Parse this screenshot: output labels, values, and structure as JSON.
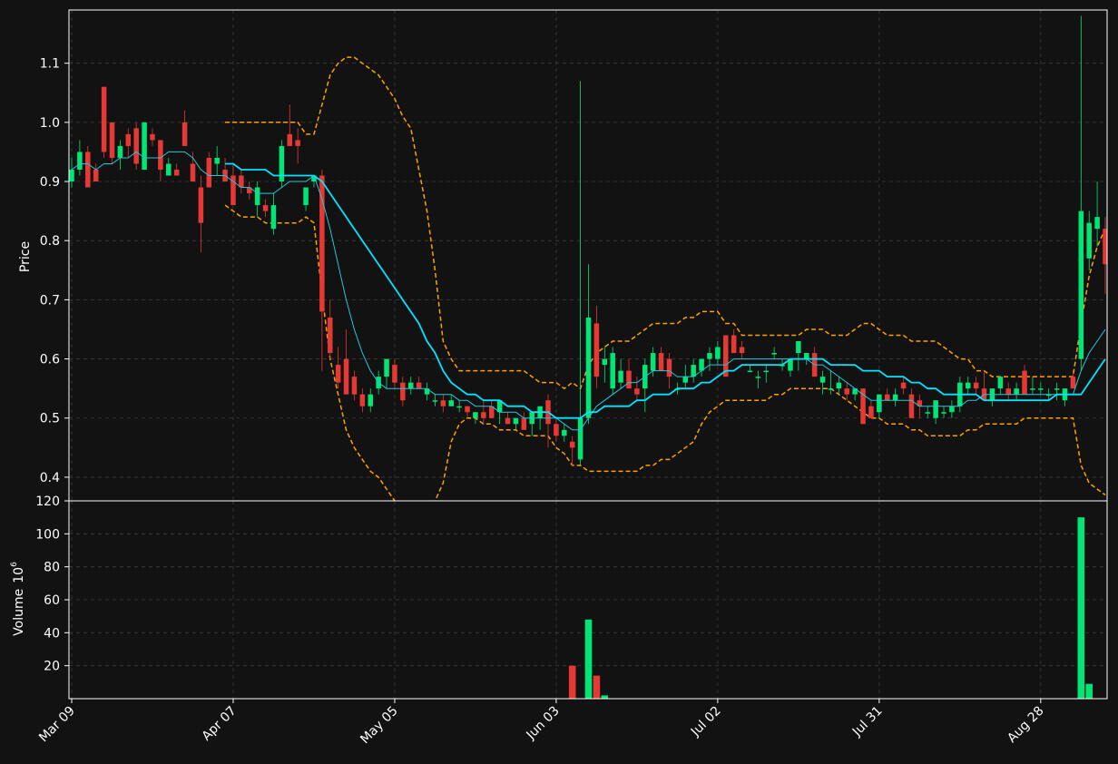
{
  "chart_data": {
    "type": "candlestick",
    "ylabel_price": "Price",
    "ylabel_volume": "Volume",
    "volume_unit": "10",
    "volume_unit_exp": "6",
    "colors": {
      "background": "#121212",
      "up": "#00e676",
      "down": "#e53935",
      "ma_fast": "#26c6da",
      "ma_slow": "#00e5ff",
      "bollinger": "#ffa000",
      "grid": "#3a3a3a",
      "axis": "#ffffff"
    },
    "grid": true,
    "x_tick_labels": [
      "Mar 09",
      "Apr 07",
      "May 05",
      "Jun 03",
      "Jul 02",
      "Jul 31",
      "Aug 28"
    ],
    "x_tick_index": [
      0,
      20,
      40,
      60,
      80,
      100,
      120
    ],
    "price_ylim": [
      0.36,
      1.19
    ],
    "price_ticks": [
      "0.4",
      "0.5",
      "0.6",
      "0.7",
      "0.8",
      "0.9",
      "1.0",
      "1.1"
    ],
    "volume_ylim": [
      0,
      120
    ],
    "volume_ticks": [
      "20",
      "40",
      "60",
      "80",
      "100",
      "120"
    ],
    "candles": [
      [
        0.9,
        0.94,
        0.89,
        0.92
      ],
      [
        0.92,
        0.97,
        0.91,
        0.95
      ],
      [
        0.95,
        0.96,
        0.89,
        0.89
      ],
      [
        0.92,
        0.93,
        0.9,
        0.9
      ],
      [
        1.06,
        1.06,
        0.94,
        0.95
      ],
      [
        1.0,
        1.0,
        0.93,
        0.94
      ],
      [
        0.94,
        0.97,
        0.92,
        0.96
      ],
      [
        0.98,
        0.99,
        0.94,
        0.96
      ],
      [
        0.99,
        1.0,
        0.92,
        0.93
      ],
      [
        0.92,
        1.0,
        0.92,
        1.0
      ],
      [
        0.98,
        0.99,
        0.96,
        0.97
      ],
      [
        0.97,
        0.97,
        0.9,
        0.92
      ],
      [
        0.91,
        0.94,
        0.91,
        0.93
      ],
      [
        0.92,
        0.93,
        0.91,
        0.91
      ],
      [
        1.0,
        1.02,
        0.96,
        0.96
      ],
      [
        0.93,
        0.95,
        0.9,
        0.9
      ],
      [
        0.89,
        0.91,
        0.78,
        0.83
      ],
      [
        0.94,
        0.95,
        0.89,
        0.89
      ],
      [
        0.93,
        0.96,
        0.91,
        0.94
      ],
      [
        0.92,
        0.94,
        0.91,
        0.9
      ],
      [
        0.91,
        0.93,
        0.86,
        0.86
      ],
      [
        0.91,
        0.92,
        0.88,
        0.89
      ],
      [
        0.89,
        0.9,
        0.87,
        0.88
      ],
      [
        0.86,
        0.9,
        0.84,
        0.89
      ],
      [
        0.86,
        0.87,
        0.84,
        0.85
      ],
      [
        0.82,
        0.88,
        0.81,
        0.86
      ],
      [
        0.9,
        0.97,
        0.89,
        0.96
      ],
      [
        0.98,
        1.03,
        0.96,
        0.96
      ],
      [
        0.97,
        0.99,
        0.93,
        0.96
      ],
      [
        0.86,
        0.88,
        0.85,
        0.89
      ],
      [
        0.9,
        0.91,
        0.89,
        0.91
      ],
      [
        0.91,
        0.92,
        0.58,
        0.68
      ],
      [
        0.67,
        0.7,
        0.6,
        0.61
      ],
      [
        0.59,
        0.62,
        0.55,
        0.56
      ],
      [
        0.6,
        0.65,
        0.55,
        0.54
      ],
      [
        0.57,
        0.58,
        0.53,
        0.54
      ],
      [
        0.54,
        0.55,
        0.51,
        0.52
      ],
      [
        0.52,
        0.55,
        0.51,
        0.54
      ],
      [
        0.55,
        0.58,
        0.54,
        0.57
      ],
      [
        0.57,
        0.6,
        0.55,
        0.6
      ],
      [
        0.59,
        0.6,
        0.55,
        0.56
      ],
      [
        0.56,
        0.57,
        0.52,
        0.53
      ],
      [
        0.55,
        0.57,
        0.54,
        0.56
      ],
      [
        0.56,
        0.57,
        0.55,
        0.55
      ],
      [
        0.54,
        0.56,
        0.53,
        0.55
      ],
      [
        0.53,
        0.54,
        0.52,
        0.53
      ],
      [
        0.53,
        0.54,
        0.51,
        0.52
      ],
      [
        0.52,
        0.54,
        0.52,
        0.53
      ],
      [
        0.52,
        0.53,
        0.51,
        0.52
      ],
      [
        0.52,
        0.52,
        0.5,
        0.51
      ],
      [
        0.5,
        0.51,
        0.49,
        0.51
      ],
      [
        0.51,
        0.53,
        0.49,
        0.5
      ],
      [
        0.52,
        0.53,
        0.5,
        0.5
      ],
      [
        0.51,
        0.53,
        0.49,
        0.53
      ],
      [
        0.5,
        0.51,
        0.49,
        0.49
      ],
      [
        0.49,
        0.5,
        0.48,
        0.5
      ],
      [
        0.5,
        0.51,
        0.48,
        0.48
      ],
      [
        0.49,
        0.51,
        0.47,
        0.51
      ],
      [
        0.5,
        0.52,
        0.48,
        0.52
      ],
      [
        0.53,
        0.54,
        0.45,
        0.49
      ],
      [
        0.49,
        0.5,
        0.46,
        0.47
      ],
      [
        0.47,
        0.49,
        0.46,
        0.48
      ],
      [
        0.46,
        0.47,
        0.42,
        0.45
      ],
      [
        0.43,
        1.07,
        0.42,
        0.5
      ],
      [
        0.5,
        0.76,
        0.49,
        0.67
      ],
      [
        0.66,
        0.69,
        0.55,
        0.57
      ],
      [
        0.59,
        0.62,
        0.56,
        0.6
      ],
      [
        0.55,
        0.62,
        0.54,
        0.61
      ],
      [
        0.56,
        0.6,
        0.55,
        0.58
      ],
      [
        0.58,
        0.6,
        0.55,
        0.55
      ],
      [
        0.55,
        0.57,
        0.53,
        0.54
      ],
      [
        0.55,
        0.6,
        0.51,
        0.59
      ],
      [
        0.58,
        0.62,
        0.57,
        0.61
      ],
      [
        0.61,
        0.62,
        0.58,
        0.58
      ],
      [
        0.6,
        0.61,
        0.55,
        0.57
      ],
      [
        0.55,
        0.56,
        0.54,
        0.55
      ],
      [
        0.56,
        0.59,
        0.55,
        0.57
      ],
      [
        0.57,
        0.6,
        0.56,
        0.59
      ],
      [
        0.58,
        0.6,
        0.57,
        0.6
      ],
      [
        0.6,
        0.62,
        0.58,
        0.61
      ],
      [
        0.6,
        0.63,
        0.59,
        0.62
      ],
      [
        0.64,
        0.64,
        0.57,
        0.57
      ],
      [
        0.64,
        0.65,
        0.61,
        0.61
      ],
      [
        0.62,
        0.63,
        0.6,
        0.61
      ],
      [
        0.58,
        0.59,
        0.58,
        0.58
      ],
      [
        0.57,
        0.58,
        0.55,
        0.57
      ],
      [
        0.58,
        0.59,
        0.56,
        0.58
      ],
      [
        0.61,
        0.62,
        0.6,
        0.61
      ],
      [
        0.59,
        0.6,
        0.58,
        0.59
      ],
      [
        0.58,
        0.6,
        0.57,
        0.6
      ],
      [
        0.61,
        0.63,
        0.58,
        0.63
      ],
      [
        0.6,
        0.61,
        0.59,
        0.61
      ],
      [
        0.61,
        0.62,
        0.57,
        0.57
      ],
      [
        0.56,
        0.58,
        0.54,
        0.57
      ],
      [
        0.55,
        0.58,
        0.54,
        0.55
      ],
      [
        0.55,
        0.57,
        0.54,
        0.56
      ],
      [
        0.55,
        0.56,
        0.53,
        0.54
      ],
      [
        0.54,
        0.55,
        0.53,
        0.55
      ],
      [
        0.55,
        0.55,
        0.49,
        0.49
      ],
      [
        0.52,
        0.53,
        0.5,
        0.5
      ],
      [
        0.51,
        0.54,
        0.5,
        0.54
      ],
      [
        0.54,
        0.55,
        0.53,
        0.53
      ],
      [
        0.53,
        0.55,
        0.52,
        0.54
      ],
      [
        0.56,
        0.57,
        0.54,
        0.55
      ],
      [
        0.54,
        0.55,
        0.5,
        0.5
      ],
      [
        0.53,
        0.54,
        0.5,
        0.52
      ],
      [
        0.51,
        0.52,
        0.5,
        0.51
      ],
      [
        0.5,
        0.53,
        0.49,
        0.53
      ],
      [
        0.51,
        0.52,
        0.5,
        0.51
      ],
      [
        0.51,
        0.53,
        0.5,
        0.52
      ],
      [
        0.52,
        0.57,
        0.51,
        0.56
      ],
      [
        0.55,
        0.57,
        0.54,
        0.56
      ],
      [
        0.56,
        0.57,
        0.54,
        0.55
      ],
      [
        0.55,
        0.58,
        0.53,
        0.53
      ],
      [
        0.53,
        0.55,
        0.52,
        0.55
      ],
      [
        0.55,
        0.57,
        0.54,
        0.57
      ],
      [
        0.55,
        0.56,
        0.53,
        0.54
      ],
      [
        0.54,
        0.56,
        0.53,
        0.55
      ],
      [
        0.58,
        0.59,
        0.54,
        0.54
      ],
      [
        0.55,
        0.57,
        0.54,
        0.55
      ],
      [
        0.55,
        0.56,
        0.54,
        0.55
      ],
      [
        0.54,
        0.55,
        0.53,
        0.54
      ],
      [
        0.55,
        0.56,
        0.53,
        0.55
      ],
      [
        0.53,
        0.55,
        0.52,
        0.55
      ],
      [
        0.57,
        0.58,
        0.55,
        0.55
      ],
      [
        0.6,
        1.18,
        0.58,
        0.85
      ],
      [
        0.77,
        0.85,
        0.75,
        0.83
      ],
      [
        0.82,
        0.9,
        0.79,
        0.84
      ],
      [
        0.82,
        0.84,
        0.71,
        0.76
      ]
    ],
    "volume": [
      0,
      0,
      0,
      0,
      0,
      0,
      0,
      0,
      0,
      0,
      0,
      0,
      0,
      0,
      0,
      0,
      0,
      0,
      0,
      0,
      0,
      0,
      0,
      0,
      0,
      0,
      0,
      0,
      0,
      0,
      0,
      0,
      0,
      0,
      0,
      0,
      0,
      0,
      0,
      0,
      0,
      0,
      0,
      0,
      0,
      0,
      0,
      0,
      0,
      0,
      0,
      0,
      0,
      0,
      0,
      0,
      0,
      0,
      0,
      0,
      0,
      0,
      20,
      0,
      48,
      14,
      2,
      0,
      0,
      0,
      0,
      0,
      0,
      0,
      0,
      0,
      0,
      0,
      0,
      0,
      0,
      0,
      0,
      0,
      0,
      0,
      0,
      0,
      0,
      0,
      0,
      0,
      0,
      0,
      0,
      0,
      0,
      0,
      0,
      0,
      0,
      0,
      0,
      0,
      0,
      0,
      0,
      0,
      0,
      0,
      0,
      0,
      0,
      0,
      0,
      0,
      0,
      0,
      0,
      0,
      0,
      0,
      0,
      0,
      0,
      110,
      9,
      0,
      0
    ],
    "ma_fast": [
      0.92,
      0.93,
      0.93,
      0.92,
      0.93,
      0.93,
      0.94,
      0.94,
      0.95,
      0.94,
      0.94,
      0.94,
      0.95,
      0.95,
      0.95,
      0.94,
      0.92,
      0.91,
      0.91,
      0.91,
      0.9,
      0.89,
      0.89,
      0.88,
      0.88,
      0.88,
      0.89,
      0.9,
      0.9,
      0.9,
      0.91,
      0.87,
      0.82,
      0.76,
      0.7,
      0.65,
      0.61,
      0.58,
      0.56,
      0.55,
      0.55,
      0.55,
      0.55,
      0.55,
      0.55,
      0.54,
      0.54,
      0.54,
      0.53,
      0.53,
      0.52,
      0.52,
      0.52,
      0.51,
      0.51,
      0.51,
      0.5,
      0.5,
      0.5,
      0.5,
      0.5,
      0.49,
      0.48,
      0.48,
      0.5,
      0.52,
      0.53,
      0.54,
      0.55,
      0.56,
      0.56,
      0.57,
      0.58,
      0.58,
      0.58,
      0.57,
      0.57,
      0.57,
      0.58,
      0.59,
      0.59,
      0.59,
      0.6,
      0.6,
      0.6,
      0.6,
      0.6,
      0.6,
      0.6,
      0.6,
      0.6,
      0.6,
      0.59,
      0.59,
      0.58,
      0.57,
      0.56,
      0.55,
      0.54,
      0.53,
      0.53,
      0.53,
      0.53,
      0.53,
      0.53,
      0.52,
      0.52,
      0.52,
      0.52,
      0.52,
      0.52,
      0.53,
      0.53,
      0.54,
      0.54,
      0.54,
      0.54,
      0.54,
      0.54,
      0.54,
      0.54,
      0.54,
      0.54,
      0.54,
      0.54,
      0.58,
      0.61,
      0.63,
      0.65
    ],
    "ma_slow": [
      null,
      null,
      null,
      null,
      null,
      null,
      null,
      null,
      null,
      null,
      null,
      null,
      null,
      null,
      null,
      null,
      null,
      null,
      null,
      0.93,
      0.93,
      0.92,
      0.92,
      0.92,
      0.92,
      0.91,
      0.91,
      0.91,
      0.91,
      0.91,
      0.91,
      0.9,
      0.88,
      0.86,
      0.84,
      0.82,
      0.8,
      0.78,
      0.76,
      0.74,
      0.72,
      0.7,
      0.68,
      0.66,
      0.63,
      0.61,
      0.58,
      0.56,
      0.55,
      0.54,
      0.54,
      0.53,
      0.53,
      0.53,
      0.52,
      0.52,
      0.52,
      0.51,
      0.51,
      0.51,
      0.5,
      0.5,
      0.5,
      0.5,
      0.51,
      0.51,
      0.52,
      0.52,
      0.52,
      0.52,
      0.53,
      0.53,
      0.54,
      0.54,
      0.54,
      0.55,
      0.55,
      0.55,
      0.56,
      0.56,
      0.57,
      0.58,
      0.58,
      0.59,
      0.59,
      0.59,
      0.59,
      0.59,
      0.59,
      0.6,
      0.6,
      0.6,
      0.6,
      0.6,
      0.59,
      0.59,
      0.59,
      0.59,
      0.58,
      0.58,
      0.58,
      0.57,
      0.57,
      0.57,
      0.56,
      0.56,
      0.55,
      0.55,
      0.54,
      0.54,
      0.54,
      0.54,
      0.54,
      0.53,
      0.53,
      0.53,
      0.53,
      0.53,
      0.53,
      0.53,
      0.53,
      0.53,
      0.54,
      0.54,
      0.54,
      0.54,
      0.56,
      0.58,
      0.6
    ],
    "bb_upper": [
      null,
      null,
      null,
      null,
      null,
      null,
      null,
      null,
      null,
      null,
      null,
      null,
      null,
      null,
      null,
      null,
      null,
      null,
      null,
      1.0,
      1.0,
      1.0,
      1.0,
      1.0,
      1.0,
      1.0,
      1.0,
      1.0,
      1.0,
      0.98,
      0.98,
      1.03,
      1.08,
      1.1,
      1.11,
      1.11,
      1.1,
      1.09,
      1.08,
      1.06,
      1.04,
      1.01,
      0.99,
      0.92,
      0.85,
      0.75,
      0.63,
      0.6,
      0.58,
      0.58,
      0.58,
      0.58,
      0.58,
      0.58,
      0.58,
      0.58,
      0.58,
      0.57,
      0.56,
      0.56,
      0.56,
      0.55,
      0.56,
      0.55,
      0.59,
      0.61,
      0.62,
      0.63,
      0.63,
      0.63,
      0.64,
      0.65,
      0.66,
      0.66,
      0.66,
      0.66,
      0.67,
      0.67,
      0.68,
      0.68,
      0.68,
      0.66,
      0.66,
      0.64,
      0.64,
      0.64,
      0.64,
      0.64,
      0.64,
      0.64,
      0.64,
      0.65,
      0.65,
      0.65,
      0.64,
      0.64,
      0.64,
      0.65,
      0.66,
      0.66,
      0.65,
      0.64,
      0.64,
      0.64,
      0.63,
      0.63,
      0.63,
      0.63,
      0.62,
      0.61,
      0.6,
      0.6,
      0.58,
      0.58,
      0.57,
      0.57,
      0.57,
      0.57,
      0.57,
      0.57,
      0.57,
      0.57,
      0.57,
      0.57,
      0.57,
      0.66,
      0.74,
      0.79,
      0.82
    ],
    "bb_lower": [
      null,
      null,
      null,
      null,
      null,
      null,
      null,
      null,
      null,
      null,
      null,
      null,
      null,
      null,
      null,
      null,
      null,
      null,
      null,
      0.86,
      0.85,
      0.84,
      0.84,
      0.84,
      0.83,
      0.83,
      0.83,
      0.83,
      0.83,
      0.84,
      0.83,
      0.71,
      0.6,
      0.54,
      0.48,
      0.45,
      0.43,
      0.41,
      0.4,
      0.38,
      0.36,
      0.34,
      0.32,
      0.32,
      0.33,
      0.36,
      0.39,
      0.46,
      0.49,
      0.5,
      0.5,
      0.49,
      0.49,
      0.48,
      0.48,
      0.48,
      0.47,
      0.47,
      0.47,
      0.47,
      0.45,
      0.44,
      0.42,
      0.42,
      0.41,
      0.41,
      0.41,
      0.41,
      0.41,
      0.41,
      0.41,
      0.42,
      0.42,
      0.43,
      0.43,
      0.44,
      0.45,
      0.46,
      0.49,
      0.51,
      0.52,
      0.53,
      0.53,
      0.53,
      0.53,
      0.53,
      0.53,
      0.54,
      0.54,
      0.55,
      0.55,
      0.55,
      0.55,
      0.55,
      0.55,
      0.54,
      0.53,
      0.52,
      0.51,
      0.5,
      0.5,
      0.49,
      0.49,
      0.49,
      0.48,
      0.48,
      0.47,
      0.47,
      0.47,
      0.47,
      0.47,
      0.48,
      0.48,
      0.49,
      0.49,
      0.49,
      0.49,
      0.49,
      0.5,
      0.5,
      0.5,
      0.5,
      0.5,
      0.5,
      0.5,
      0.42,
      0.39,
      0.38,
      0.37
    ]
  }
}
